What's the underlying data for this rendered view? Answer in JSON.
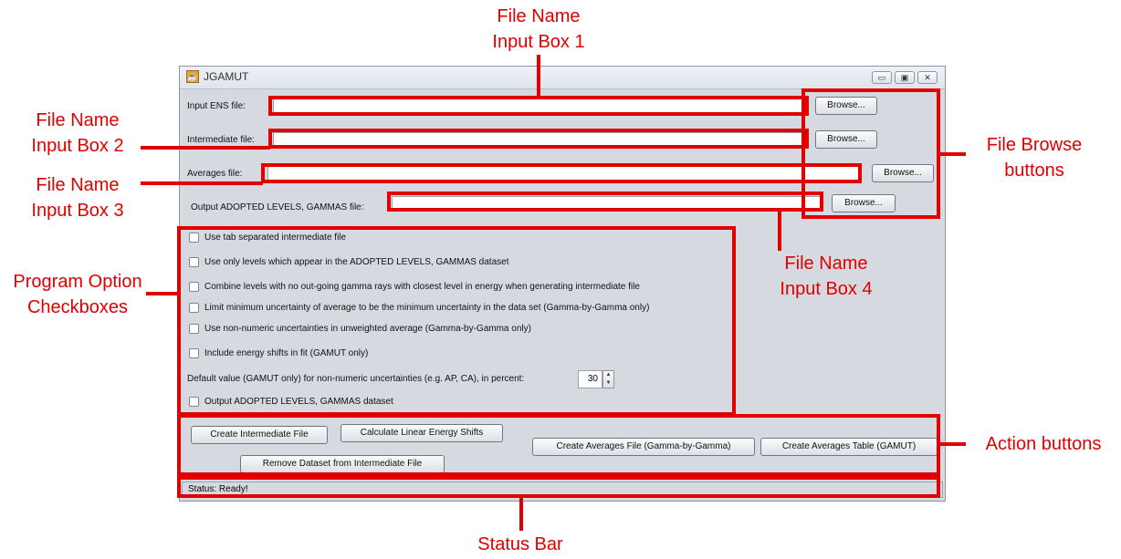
{
  "window": {
    "title": "JGAMUT",
    "controls": {
      "minimize": "▭",
      "maximize": "▣",
      "close": "✕"
    }
  },
  "files": {
    "ens_label": "Input ENS file:",
    "ens_value": "",
    "intermediate_label": "Intermediate file:",
    "intermediate_value": "",
    "averages_label": "Averages file:",
    "averages_value": "",
    "output_label": "Output ADOPTED LEVELS, GAMMAS file:",
    "output_value": "",
    "browse": "Browse..."
  },
  "options": [
    "Use tab separated intermediate file",
    "Use only levels which appear in the ADOPTED LEVELS, GAMMAS dataset",
    "Combine levels with no out-going gamma rays with closest level in energy when generating intermediate file",
    "Limit minimum uncertainty of average to be the minimum uncertainty in the data set (Gamma-by-Gamma only)",
    "Use non-numeric uncertainties in unweighted average (Gamma-by-Gamma only)",
    "Include energy shifts in fit (GAMUT only)",
    "Output ADOPTED LEVELS, GAMMAS dataset"
  ],
  "default_value": {
    "label": "Default value (GAMUT only) for non-numeric uncertainties (e.g. AP, CA), in percent:",
    "value": "30"
  },
  "actions": {
    "create_intermediate": "Create Intermediate File",
    "calc_shifts": "Calculate Linear Energy Shifts",
    "remove_dataset": "Remove Dataset from Intermediate File",
    "create_averages_file": "Create Averages File (Gamma-by-Gamma)",
    "create_averages_table": "Create Averages Table (GAMUT)"
  },
  "status": "Status: Ready!",
  "annotations": {
    "input1_line1": "File Name",
    "input1_line2": "Input Box 1",
    "input2_line1": "File Name",
    "input2_line2": "Input Box 2",
    "input3_line1": "File Name",
    "input3_line2": "Input Box 3",
    "input4_line1": "File Name",
    "input4_line2": "Input Box 4",
    "browse_line1": "File Browse",
    "browse_line2": "buttons",
    "options_line1": "Program Option",
    "options_line2": "Checkboxes",
    "actions": "Action buttons",
    "status": "Status Bar"
  },
  "colors": {
    "annotation": "#e00000",
    "window_bg": "#d6d9df"
  }
}
